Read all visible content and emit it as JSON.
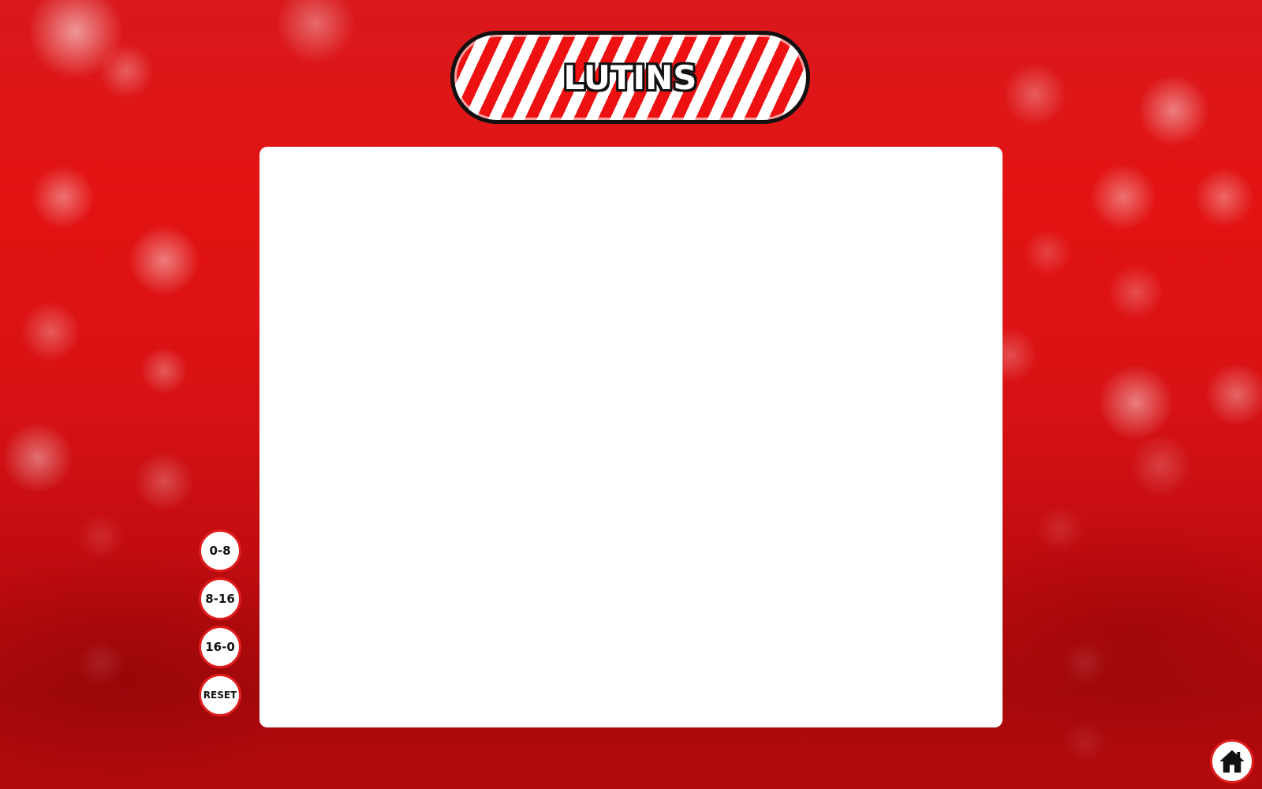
{
  "header": {
    "title": "LUTINS"
  },
  "controls": {
    "buttons": [
      {
        "label": "0-8"
      },
      {
        "label": "8-16"
      },
      {
        "label": "16-0"
      },
      {
        "label": "RESET"
      }
    ]
  },
  "home": {
    "icon": "home-icon"
  },
  "colors": {
    "accent_red": "#e01e1e",
    "background_red": "#d81214",
    "board_white": "#ffffff"
  }
}
